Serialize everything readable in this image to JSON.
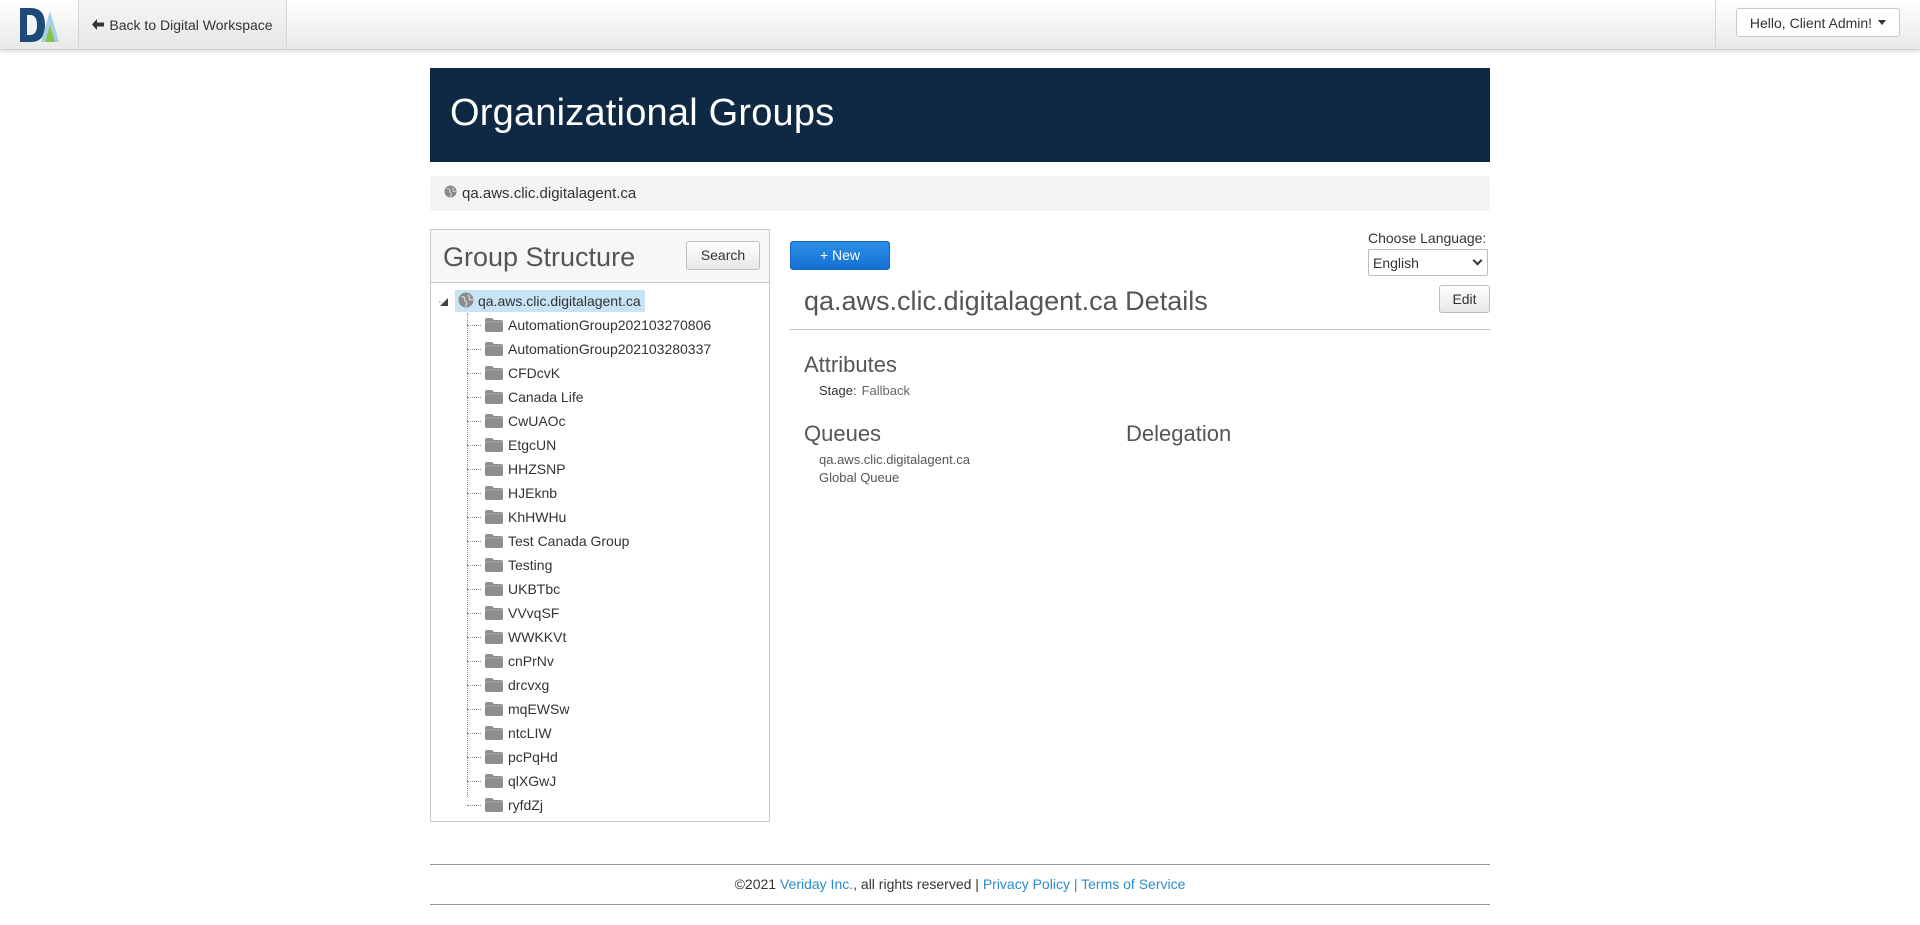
{
  "topbar": {
    "back_label": "Back to Digital Workspace",
    "user_greeting": "Hello, Client Admin!"
  },
  "header": {
    "title": "Organizational Groups"
  },
  "breadcrumb": {
    "domain": "qa.aws.clic.digitalagent.ca"
  },
  "group_panel": {
    "title": "Group Structure",
    "search_label": "Search",
    "root": "qa.aws.clic.digitalagent.ca",
    "items": [
      "AutomationGroup202103270806",
      "AutomationGroup202103280337",
      "CFDcvK",
      "Canada Life",
      "CwUAOc",
      "EtgcUN",
      "HHZSNP",
      "HJEknb",
      "KhHWHu",
      "Test Canada Group",
      "Testing",
      "UKBTbc",
      "VVvqSF",
      "WWKKVt",
      "cnPrNv",
      "drcvxg",
      "mqEWSw",
      "ntcLIW",
      "pcPqHd",
      "qlXGwJ",
      "ryfdZj"
    ]
  },
  "details": {
    "new_label": "+ New",
    "language_label": "Choose Language:",
    "language_value": "English",
    "title": "qa.aws.clic.digitalagent.ca Details",
    "edit_label": "Edit",
    "attributes_title": "Attributes",
    "stage_key": "Stage:",
    "stage_value": "Fallback",
    "queues_title": "Queues",
    "delegation_title": "Delegation",
    "queues": [
      "qa.aws.clic.digitalagent.ca",
      "Global Queue"
    ]
  },
  "footer": {
    "copyright": "©2021",
    "company": "Veriday Inc.",
    "rights": ", all rights reserved |",
    "privacy": "Privacy Policy",
    "sep": "|",
    "terms": "Terms of Service"
  },
  "colors": {
    "header_bg": "#0f2844",
    "accent_blue": "#1670d3",
    "link": "#2b8bd0",
    "tree_selected": "#c7e4f7"
  }
}
